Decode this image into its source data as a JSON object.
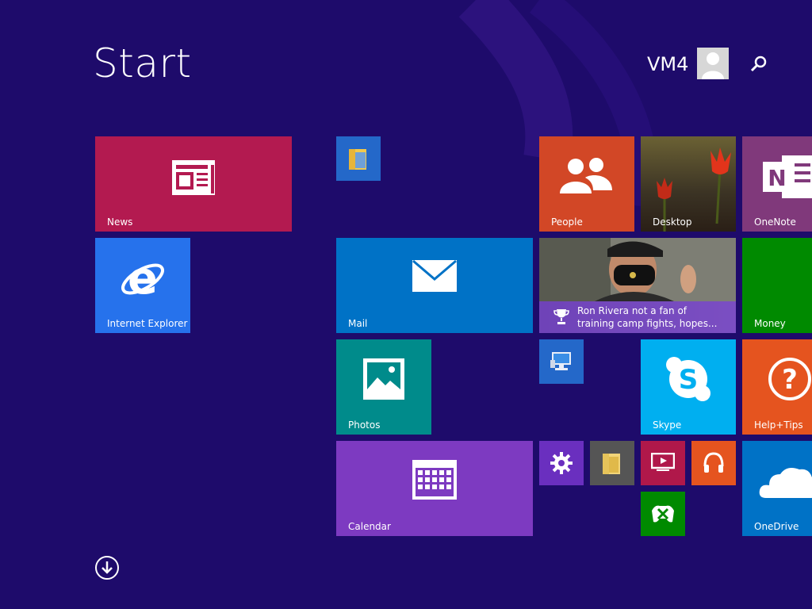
{
  "start": {
    "title": "Start"
  },
  "user": {
    "name": "VM4",
    "avatar_icon": "user-avatar-icon"
  },
  "search": {
    "icon": "search-icon"
  },
  "tiles": {
    "news": {
      "label": "News",
      "color": "#b31a50",
      "icon": "news-icon"
    },
    "ie": {
      "label": "Internet Explorer",
      "color": "#2672ec",
      "icon": "internet-explorer-icon"
    },
    "file_explorer_small": {
      "label": "",
      "color": "#2468c9",
      "icon": "folder-icon"
    },
    "mail": {
      "label": "Mail",
      "color": "#0072c6",
      "icon": "mail-icon"
    },
    "photos": {
      "label": "Photos",
      "color": "#008b8b",
      "icon": "photo-icon"
    },
    "calendar": {
      "label": "Calendar",
      "color": "#7d3ac1",
      "icon": "calendar-icon"
    },
    "people": {
      "label": "People",
      "color": "#d24726",
      "icon": "people-icon"
    },
    "desktop": {
      "label": "Desktop",
      "color": "#3b3324",
      "icon": "tulip-image"
    },
    "onenote": {
      "label": "OneNote",
      "color": "#80397b",
      "icon": "onenote-icon"
    },
    "sports": {
      "headline_line1": "Ron Rivera not a fan of",
      "headline_line2": "training camp fights, hopes...",
      "icon": "trophy-icon"
    },
    "money": {
      "label": "Money",
      "color": "#008a00",
      "icon": ""
    },
    "this_pc": {
      "label": "",
      "color": "#2468c9",
      "icon": "computer-icon"
    },
    "skype": {
      "label": "Skype",
      "color": "#00aff0",
      "icon": "skype-icon"
    },
    "help_tips": {
      "label": "Help+Tips",
      "color": "#e5541f",
      "icon": "help-icon"
    },
    "settings": {
      "label": "",
      "color": "#6a2fbf",
      "icon": "gear-icon"
    },
    "file_explorer": {
      "label": "",
      "color": "#555555",
      "icon": "folder-icon"
    },
    "video": {
      "label": "",
      "color": "#b0184a",
      "icon": "video-icon"
    },
    "music": {
      "label": "",
      "color": "#e5541f",
      "icon": "headphones-icon"
    },
    "games": {
      "label": "",
      "color": "#008a00",
      "icon": "xbox-icon"
    },
    "onedrive": {
      "label": "OneDrive",
      "color": "#0072c6",
      "icon": "cloud-icon"
    }
  },
  "all_apps": {
    "icon": "arrow-down-circle-icon"
  }
}
